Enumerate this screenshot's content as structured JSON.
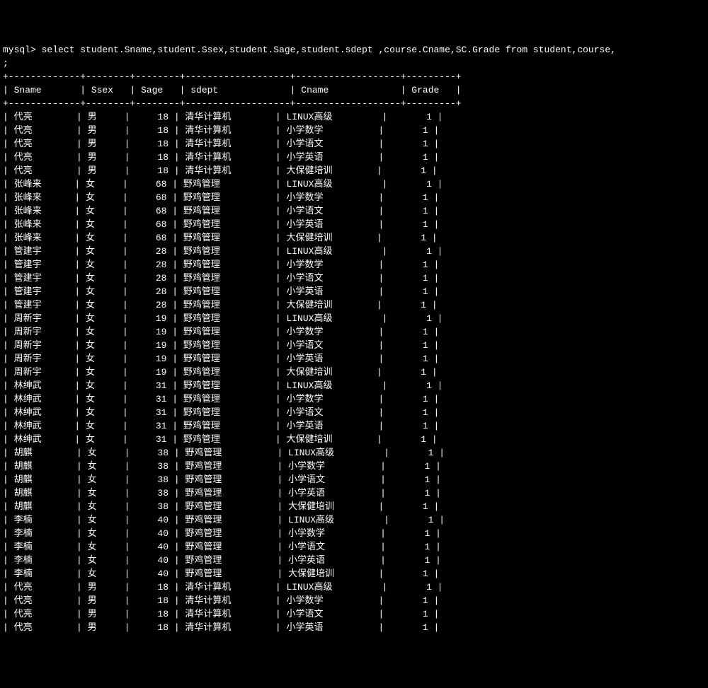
{
  "prompt": "mysql> select student.Sname,student.Ssex,student.Sage,student.sdept ,course.Cname,SC.Grade from student,course,",
  "prompt2": ";",
  "columns": [
    "Sname",
    "Ssex",
    "Sage",
    "sdept",
    "Cname",
    "Grade"
  ],
  "rows": [
    {
      "Sname": "代亮",
      "Ssex": "男",
      "Sage": 18,
      "sdept": "清华计算机",
      "Cname": "LINUX高级",
      "Grade": 1
    },
    {
      "Sname": "代亮",
      "Ssex": "男",
      "Sage": 18,
      "sdept": "清华计算机",
      "Cname": "小学数学",
      "Grade": 1
    },
    {
      "Sname": "代亮",
      "Ssex": "男",
      "Sage": 18,
      "sdept": "清华计算机",
      "Cname": "小学语文",
      "Grade": 1
    },
    {
      "Sname": "代亮",
      "Ssex": "男",
      "Sage": 18,
      "sdept": "清华计算机",
      "Cname": "小学英语",
      "Grade": 1
    },
    {
      "Sname": "代亮",
      "Ssex": "男",
      "Sage": 18,
      "sdept": "清华计算机",
      "Cname": "大保健培训",
      "Grade": 1
    },
    {
      "Sname": "张峰来",
      "Ssex": "女",
      "Sage": 68,
      "sdept": "野鸡管理",
      "Cname": "LINUX高级",
      "Grade": 1
    },
    {
      "Sname": "张峰来",
      "Ssex": "女",
      "Sage": 68,
      "sdept": "野鸡管理",
      "Cname": "小学数学",
      "Grade": 1
    },
    {
      "Sname": "张峰来",
      "Ssex": "女",
      "Sage": 68,
      "sdept": "野鸡管理",
      "Cname": "小学语文",
      "Grade": 1
    },
    {
      "Sname": "张峰来",
      "Ssex": "女",
      "Sage": 68,
      "sdept": "野鸡管理",
      "Cname": "小学英语",
      "Grade": 1
    },
    {
      "Sname": "张峰来",
      "Ssex": "女",
      "Sage": 68,
      "sdept": "野鸡管理",
      "Cname": "大保健培训",
      "Grade": 1
    },
    {
      "Sname": "管建宇",
      "Ssex": "女",
      "Sage": 28,
      "sdept": "野鸡管理",
      "Cname": "LINUX高级",
      "Grade": 1
    },
    {
      "Sname": "管建宇",
      "Ssex": "女",
      "Sage": 28,
      "sdept": "野鸡管理",
      "Cname": "小学数学",
      "Grade": 1
    },
    {
      "Sname": "管建宇",
      "Ssex": "女",
      "Sage": 28,
      "sdept": "野鸡管理",
      "Cname": "小学语文",
      "Grade": 1
    },
    {
      "Sname": "管建宇",
      "Ssex": "女",
      "Sage": 28,
      "sdept": "野鸡管理",
      "Cname": "小学英语",
      "Grade": 1
    },
    {
      "Sname": "管建宇",
      "Ssex": "女",
      "Sage": 28,
      "sdept": "野鸡管理",
      "Cname": "大保健培训",
      "Grade": 1
    },
    {
      "Sname": "周新宇",
      "Ssex": "女",
      "Sage": 19,
      "sdept": "野鸡管理",
      "Cname": "LINUX高级",
      "Grade": 1
    },
    {
      "Sname": "周新宇",
      "Ssex": "女",
      "Sage": 19,
      "sdept": "野鸡管理",
      "Cname": "小学数学",
      "Grade": 1
    },
    {
      "Sname": "周新宇",
      "Ssex": "女",
      "Sage": 19,
      "sdept": "野鸡管理",
      "Cname": "小学语文",
      "Grade": 1
    },
    {
      "Sname": "周新宇",
      "Ssex": "女",
      "Sage": 19,
      "sdept": "野鸡管理",
      "Cname": "小学英语",
      "Grade": 1
    },
    {
      "Sname": "周新宇",
      "Ssex": "女",
      "Sage": 19,
      "sdept": "野鸡管理",
      "Cname": "大保健培训",
      "Grade": 1
    },
    {
      "Sname": "林绅武",
      "Ssex": "女",
      "Sage": 31,
      "sdept": "野鸡管理",
      "Cname": "LINUX高级",
      "Grade": 1
    },
    {
      "Sname": "林绅武",
      "Ssex": "女",
      "Sage": 31,
      "sdept": "野鸡管理",
      "Cname": "小学数学",
      "Grade": 1
    },
    {
      "Sname": "林绅武",
      "Ssex": "女",
      "Sage": 31,
      "sdept": "野鸡管理",
      "Cname": "小学语文",
      "Grade": 1
    },
    {
      "Sname": "林绅武",
      "Ssex": "女",
      "Sage": 31,
      "sdept": "野鸡管理",
      "Cname": "小学英语",
      "Grade": 1
    },
    {
      "Sname": "林绅武",
      "Ssex": "女",
      "Sage": 31,
      "sdept": "野鸡管理",
      "Cname": "大保健培训",
      "Grade": 1
    },
    {
      "Sname": "胡麒",
      "Ssex": "女",
      "Sage": 38,
      "sdept": "野鸡管理",
      "Cname": "LINUX高级",
      "Grade": 1
    },
    {
      "Sname": "胡麒",
      "Ssex": "女",
      "Sage": 38,
      "sdept": "野鸡管理",
      "Cname": "小学数学",
      "Grade": 1
    },
    {
      "Sname": "胡麒",
      "Ssex": "女",
      "Sage": 38,
      "sdept": "野鸡管理",
      "Cname": "小学语文",
      "Grade": 1
    },
    {
      "Sname": "胡麒",
      "Ssex": "女",
      "Sage": 38,
      "sdept": "野鸡管理",
      "Cname": "小学英语",
      "Grade": 1
    },
    {
      "Sname": "胡麒",
      "Ssex": "女",
      "Sage": 38,
      "sdept": "野鸡管理",
      "Cname": "大保健培训",
      "Grade": 1
    },
    {
      "Sname": "李楠",
      "Ssex": "女",
      "Sage": 40,
      "sdept": "野鸡管理",
      "Cname": "LINUX高级",
      "Grade": 1
    },
    {
      "Sname": "李楠",
      "Ssex": "女",
      "Sage": 40,
      "sdept": "野鸡管理",
      "Cname": "小学数学",
      "Grade": 1
    },
    {
      "Sname": "李楠",
      "Ssex": "女",
      "Sage": 40,
      "sdept": "野鸡管理",
      "Cname": "小学语文",
      "Grade": 1
    },
    {
      "Sname": "李楠",
      "Ssex": "女",
      "Sage": 40,
      "sdept": "野鸡管理",
      "Cname": "小学英语",
      "Grade": 1
    },
    {
      "Sname": "李楠",
      "Ssex": "女",
      "Sage": 40,
      "sdept": "野鸡管理",
      "Cname": "大保健培训",
      "Grade": 1
    },
    {
      "Sname": "代亮",
      "Ssex": "男",
      "Sage": 18,
      "sdept": "清华计算机",
      "Cname": "LINUX高级",
      "Grade": 1
    },
    {
      "Sname": "代亮",
      "Ssex": "男",
      "Sage": 18,
      "sdept": "清华计算机",
      "Cname": "小学数学",
      "Grade": 1
    },
    {
      "Sname": "代亮",
      "Ssex": "男",
      "Sage": 18,
      "sdept": "清华计算机",
      "Cname": "小学语文",
      "Grade": 1
    },
    {
      "Sname": "代亮",
      "Ssex": "男",
      "Sage": 18,
      "sdept": "清华计算机",
      "Cname": "小学英语",
      "Grade": 1
    }
  ],
  "widths": {
    "Sname": 11,
    "Ssex": 6,
    "Sage": 6,
    "sdept": 17,
    "Cname": 17,
    "Grade": 7
  }
}
